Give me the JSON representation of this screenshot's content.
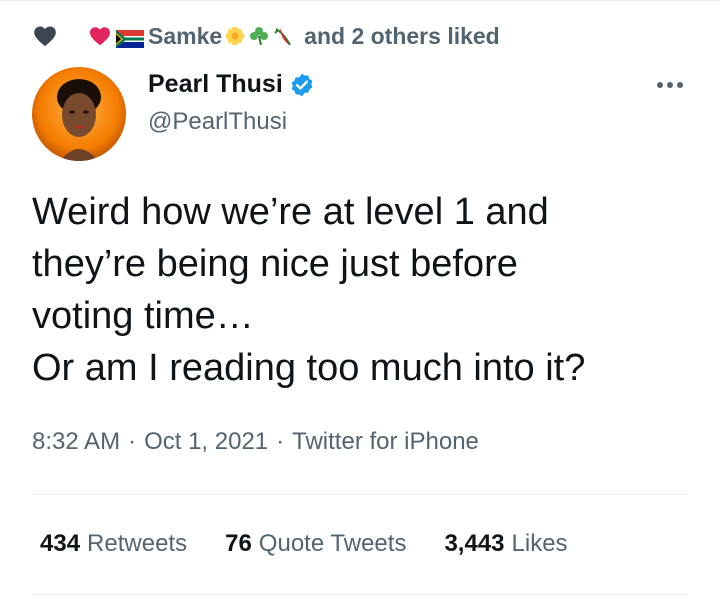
{
  "social_context": {
    "liker_name": "Samke",
    "others_text": "and 2 others liked",
    "icons": [
      "heart-icon",
      "red-heart-icon",
      "south-africa-flag-icon",
      "flower-icon",
      "clover-icon",
      "chili-icon"
    ]
  },
  "author": {
    "name": "Pearl Thusi",
    "handle": "@PearlThusi",
    "verified": true
  },
  "tweet": {
    "text": "Weird how we’re at level 1 and\nthey’re being nice just before\nvoting time…\nOr am I reading too much into it?"
  },
  "meta": {
    "time": "8:32 AM",
    "date": "Oct 1, 2021",
    "source": "Twitter for iPhone",
    "separator": "·"
  },
  "stats": {
    "retweets": {
      "count": "434",
      "label": "Retweets"
    },
    "quote_tweets": {
      "count": "76",
      "label": "Quote Tweets"
    },
    "likes": {
      "count": "3,443",
      "label": "Likes"
    }
  },
  "colors": {
    "text": "#0f1419",
    "secondary": "#536471",
    "verified": "#1d9bf0",
    "heart_grey": "#3b4651",
    "heart_red": "#e0245e",
    "divider": "#e6ecf0"
  }
}
